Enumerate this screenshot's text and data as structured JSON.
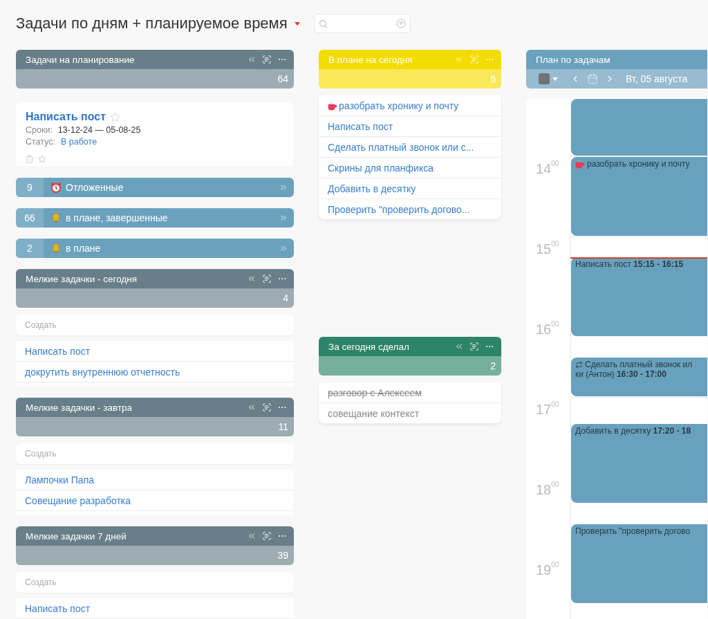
{
  "page_title": "Задачи по дням + планируемое время",
  "left_column": [
    {
      "kind": "panel",
      "title": "Задачи на планирование",
      "count": "64",
      "color": "#687f89",
      "task_card": {
        "title": "Написать пост",
        "starred": false,
        "dates_label": "Сроки:",
        "dates": "13-12-24 — 05-08-25",
        "status_label": "Статус:",
        "status": "В работе"
      }
    },
    {
      "kind": "postponed",
      "count": "9",
      "label": "Отложенные"
    },
    {
      "kind": "reminder",
      "count": "66",
      "label": "в плане, завершенные"
    },
    {
      "kind": "reminder",
      "count": "2",
      "label": "в плане"
    },
    {
      "kind": "panel",
      "title": "Мелкие задачки - сегодня",
      "count": "4",
      "color": "#687f89",
      "create_placeholder": "Создать",
      "items": [
        {
          "text": "Написать пост"
        },
        {
          "text": "докрутить внутреннюю отчетность"
        }
      ]
    },
    {
      "kind": "panel",
      "title": "Мелкие задачки - завтра",
      "count": "11",
      "color": "#687f89",
      "create_placeholder": "Создать",
      "items": [
        {
          "text": "Лампочки Папа"
        },
        {
          "text": "Совещание разработка"
        }
      ]
    },
    {
      "kind": "panel",
      "title": "Мелкие задачки 7 дней",
      "count": "39",
      "color": "#687f89",
      "create_placeholder": "Создать",
      "items": [
        {
          "text": "Написать пост"
        }
      ]
    }
  ],
  "middle_column": [
    {
      "kind": "plan",
      "title": "В плане на сегодня",
      "count": "6",
      "color": "#f5dc00",
      "items": [
        {
          "text": "разобрать хронику и почту",
          "kind": "break"
        },
        {
          "text": "Написать пост",
          "kind": "task"
        },
        {
          "text": "Сделать платный звонок или с...",
          "kind": "task"
        },
        {
          "text": "Скрины для планфикса",
          "kind": "task"
        },
        {
          "text": "Добавить в десятку",
          "kind": "task"
        },
        {
          "text": "Проверить \"проверить догово...",
          "kind": "task"
        }
      ]
    },
    {
      "kind": "done",
      "title": "За сегодня сделал",
      "count": "2",
      "color": "#2e8468",
      "items": [
        {
          "text": "разговор с Алексеем",
          "done": true
        },
        {
          "text": "совещание контекст",
          "done": false
        }
      ]
    }
  ],
  "calendar": {
    "title": "План по задачам",
    "date": "Вт, 05 августа",
    "hours": [
      {
        "label": "14$^{00}$"
      },
      {
        "label": "15$^{00}$"
      },
      {
        "label": "16$^{00}$"
      },
      {
        "label": "17$^{00}$"
      },
      {
        "label": "18$^{00}$"
      },
      {
        "label": "19$^{00}$"
      }
    ],
    "events": [
      {
        "kind": "blank"
      },
      {
        "kind": "break",
        "lines": [
          "разобрать хронику и почту"
        ]
      },
      {
        "kind": "task",
        "lines": [
          "Написать пост **15:15 - 16:15**"
        ]
      },
      {
        "kind": "recurring",
        "lines": [
          "Сделать платный звонок ил",
          "ки (Антон) **16:30 - 17:00**"
        ]
      },
      {
        "kind": "task",
        "lines": [
          "Добавить в десятку **17:20 - 18**"
        ]
      },
      {
        "kind": "task",
        "lines": [
          "Проверить \"проверить догово"
        ]
      }
    ]
  }
}
